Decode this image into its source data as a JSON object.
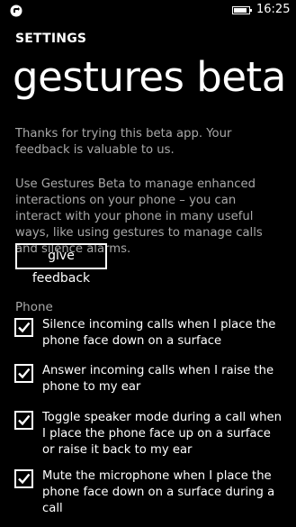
{
  "status_bar": {
    "time": "16:25"
  },
  "header": {
    "section_label": "SETTINGS",
    "title": "gestures beta"
  },
  "main": {
    "intro": "Thanks for trying this beta app. Your feedback is valuable to us.",
    "description": "Use Gestures Beta to manage enhanced interactions on your phone – you can interact with your phone in many useful ways, like using gestures to manage calls and silence alarms.",
    "feedback_button": "give feedback",
    "group_label": "Phone",
    "options": [
      {
        "label": "Silence incoming calls when I place the phone face down on a surface",
        "checked": true
      },
      {
        "label": "Answer incoming calls when I raise the phone to my ear",
        "checked": true
      },
      {
        "label": "Toggle speaker mode during a call when I place the phone face up on a surface or raise it back to my ear",
        "checked": true
      },
      {
        "label": "Mute the microphone when I place the phone face down on a surface during a call",
        "checked": true
      }
    ]
  },
  "icons": {
    "status_app": "app-status-icon",
    "battery": "battery-icon",
    "check": "checkmark-icon"
  },
  "colors": {
    "background": "#000000",
    "text": "#ffffff",
    "secondary_text": "#a8a8a8"
  }
}
